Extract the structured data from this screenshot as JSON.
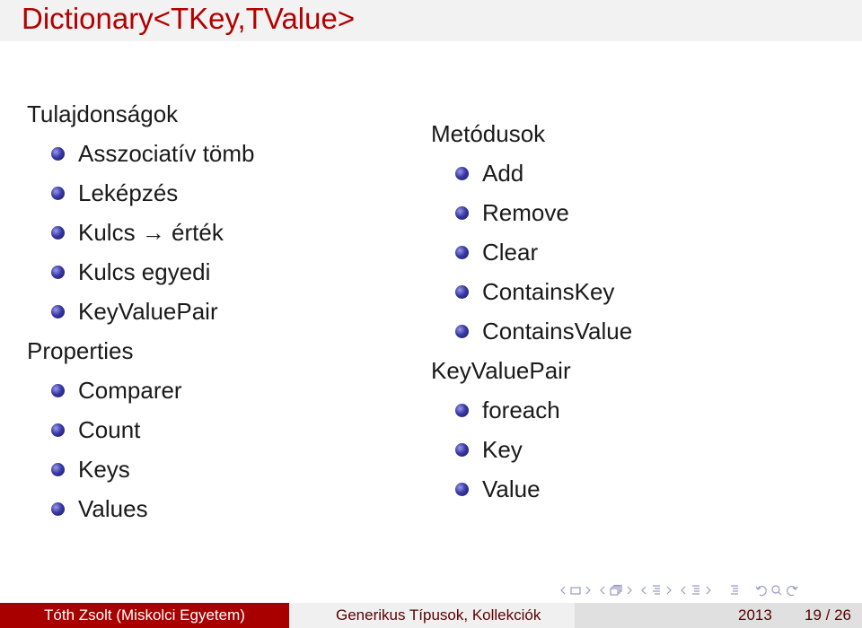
{
  "slide": {
    "title": "Dictionary<TKey,TValue>",
    "left_column": [
      {
        "heading": "Tulajdonságok",
        "items": [
          "Asszociatív tömb",
          "Leképzés",
          "Kulcs → érték",
          "Kulcs egyedi",
          "KeyValuePair"
        ]
      },
      {
        "heading": "Properties",
        "items": [
          "Comparer",
          "Count",
          "Keys",
          "Values"
        ]
      }
    ],
    "right_column": [
      {
        "heading": "Metódusok",
        "items": [
          "Add",
          "Remove",
          "Clear",
          "ContainsKey",
          "ContainsValue"
        ]
      },
      {
        "heading": "KeyValuePair",
        "items": [
          "foreach",
          "Key",
          "Value"
        ]
      }
    ]
  },
  "footer": {
    "author": "Tóth Zsolt  (Miskolci Egyetem)",
    "talk_title": "Generikus Típusok, Kollekciók",
    "year": "2013",
    "page": "19 / 26"
  },
  "navigation": {
    "icons": [
      "nav-prev-slide",
      "nav-frame",
      "nav-next-slide",
      "nav-prev-frame",
      "nav-frames",
      "nav-next-frame",
      "nav-prev-subsection",
      "nav-subsection",
      "nav-next-subsection",
      "nav-prev-section",
      "nav-section",
      "nav-next-section",
      "nav-toc",
      "nav-back",
      "nav-search",
      "nav-forward"
    ]
  },
  "colors": {
    "title": "#b30000",
    "footer_left_bg": "#a80000",
    "bullet": "#3a3aa8"
  }
}
